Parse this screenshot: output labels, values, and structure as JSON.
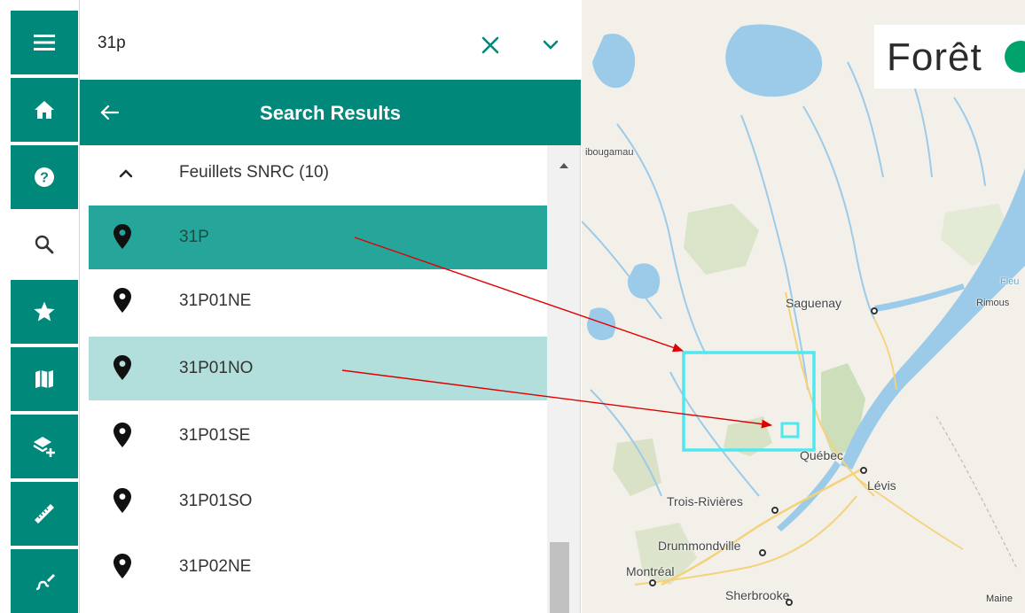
{
  "search": {
    "value": "31p",
    "placeholder": ""
  },
  "panel": {
    "title": "Search Results",
    "group": {
      "label": "Feuillets SNRC (10)",
      "expanded": true
    },
    "results": [
      {
        "label": "31P",
        "state": "selected"
      },
      {
        "label": "31P01NE",
        "state": "normal"
      },
      {
        "label": "31P01NO",
        "state": "hover"
      },
      {
        "label": "31P01SE",
        "state": "normal"
      },
      {
        "label": "31P01SO",
        "state": "normal"
      },
      {
        "label": "31P02NE",
        "state": "normal"
      }
    ]
  },
  "rail": {
    "items": [
      {
        "icon": "menu-icon"
      },
      {
        "icon": "home-icon"
      },
      {
        "icon": "help-icon"
      },
      {
        "icon": "search-icon",
        "active": true
      },
      {
        "icon": "star-icon"
      },
      {
        "icon": "map-icon"
      },
      {
        "icon": "add-layer-icon"
      },
      {
        "icon": "ruler-icon"
      },
      {
        "icon": "draw-icon"
      }
    ]
  },
  "map": {
    "logo": "Forêt",
    "places": {
      "chibougamau": "ibougamau",
      "saguenay": "Saguenay",
      "rimouski": "Rimous",
      "quebec": "Québec",
      "levis": "Lévis",
      "trois_rivieres": "Trois-Rivières",
      "drummondville": "Drummondville",
      "montreal": "Montréal",
      "sherbrooke": "Sherbrooke",
      "maine": "Maine",
      "fleuve": "Fleu"
    }
  },
  "colors": {
    "primary": "#00897b",
    "selected_row": "#26a69a",
    "hover_row": "#b2dfdb",
    "highlight_box": "#4ee8f0",
    "annotation_arrow": "#e00000"
  }
}
